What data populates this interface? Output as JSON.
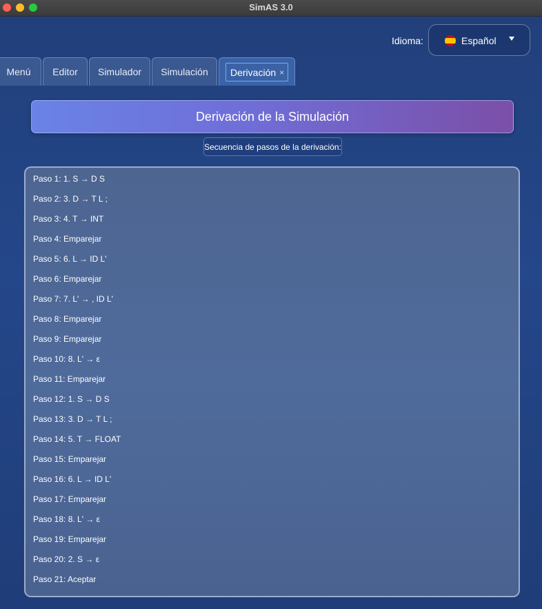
{
  "window": {
    "title": "SimAS 3.0"
  },
  "language": {
    "label": "Idioma:",
    "value": "Español"
  },
  "tabs": [
    {
      "label": "Menú"
    },
    {
      "label": "Editor"
    },
    {
      "label": "Simulador"
    },
    {
      "label": "Simulación"
    },
    {
      "label": "Derivación",
      "active": true,
      "close": "×"
    }
  ],
  "banner": {
    "title": "Derivación de la Simulación"
  },
  "subtitle": "Secuencia de pasos de la derivación:",
  "steps": [
    "Paso 1: 1. S → D S",
    "Paso 2: 3. D → T L ;",
    "Paso 3: 4. T → INT",
    "Paso 4: Emparejar",
    "Paso 5: 6. L → ID L'",
    "Paso 6: Emparejar",
    "Paso 7: 7. L' → , ID L'",
    "Paso 8: Emparejar",
    "Paso 9: Emparejar",
    "Paso 10: 8. L' → ε",
    "Paso 11: Emparejar",
    "Paso 12: 1. S → D S",
    "Paso 13: 3. D → T L ;",
    "Paso 14: 5. T → FLOAT",
    "Paso 15: Emparejar",
    "Paso 16: 6. L → ID L'",
    "Paso 17: Emparejar",
    "Paso 18: 8. L' → ε",
    "Paso 19: Emparejar",
    "Paso 20: 2. S → ε",
    "Paso 21: Aceptar"
  ],
  "colors": {
    "background": "#24478a",
    "banner_start": "#6a83e6",
    "banner_end": "#7b4fa8",
    "active_tab_focus": "#5bb8f5"
  }
}
